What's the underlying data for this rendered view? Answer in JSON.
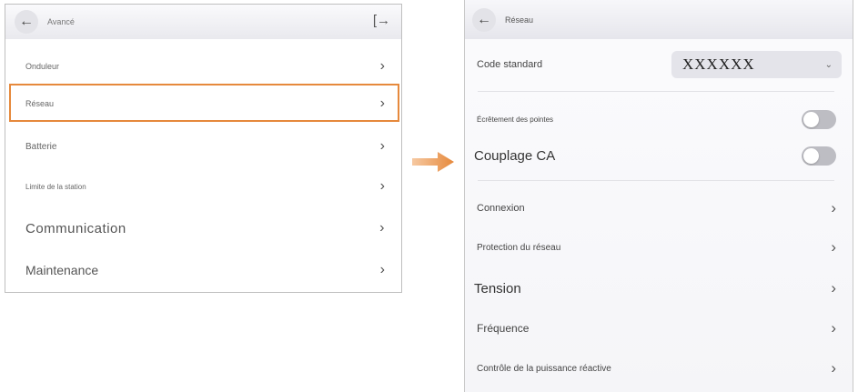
{
  "left": {
    "title": "Avancé",
    "back_icon": "←",
    "logout_icon": "[→",
    "items": [
      {
        "label": "Onduleur"
      },
      {
        "label": "Réseau"
      },
      {
        "label": "Batterie"
      },
      {
        "label": "Limite de la station"
      },
      {
        "label": "Communication"
      },
      {
        "label": "Maintenance"
      }
    ],
    "highlight_color": "#e6893c"
  },
  "right": {
    "title": "Réseau",
    "back_icon": "←",
    "code_standard": {
      "label": "Code standard",
      "value": "XXXXXX"
    },
    "toggles": [
      {
        "label": "Écrêtement des pointes",
        "on": false
      },
      {
        "label": "Couplage CA",
        "on": false
      }
    ],
    "items": [
      {
        "label": "Connexion"
      },
      {
        "label": "Protection du réseau"
      },
      {
        "label": "Tension"
      },
      {
        "label": "Fréquence"
      },
      {
        "label": "Contrôle de la puissance réactive"
      }
    ]
  },
  "arrow_color": "#e6893c",
  "chevron": "›"
}
